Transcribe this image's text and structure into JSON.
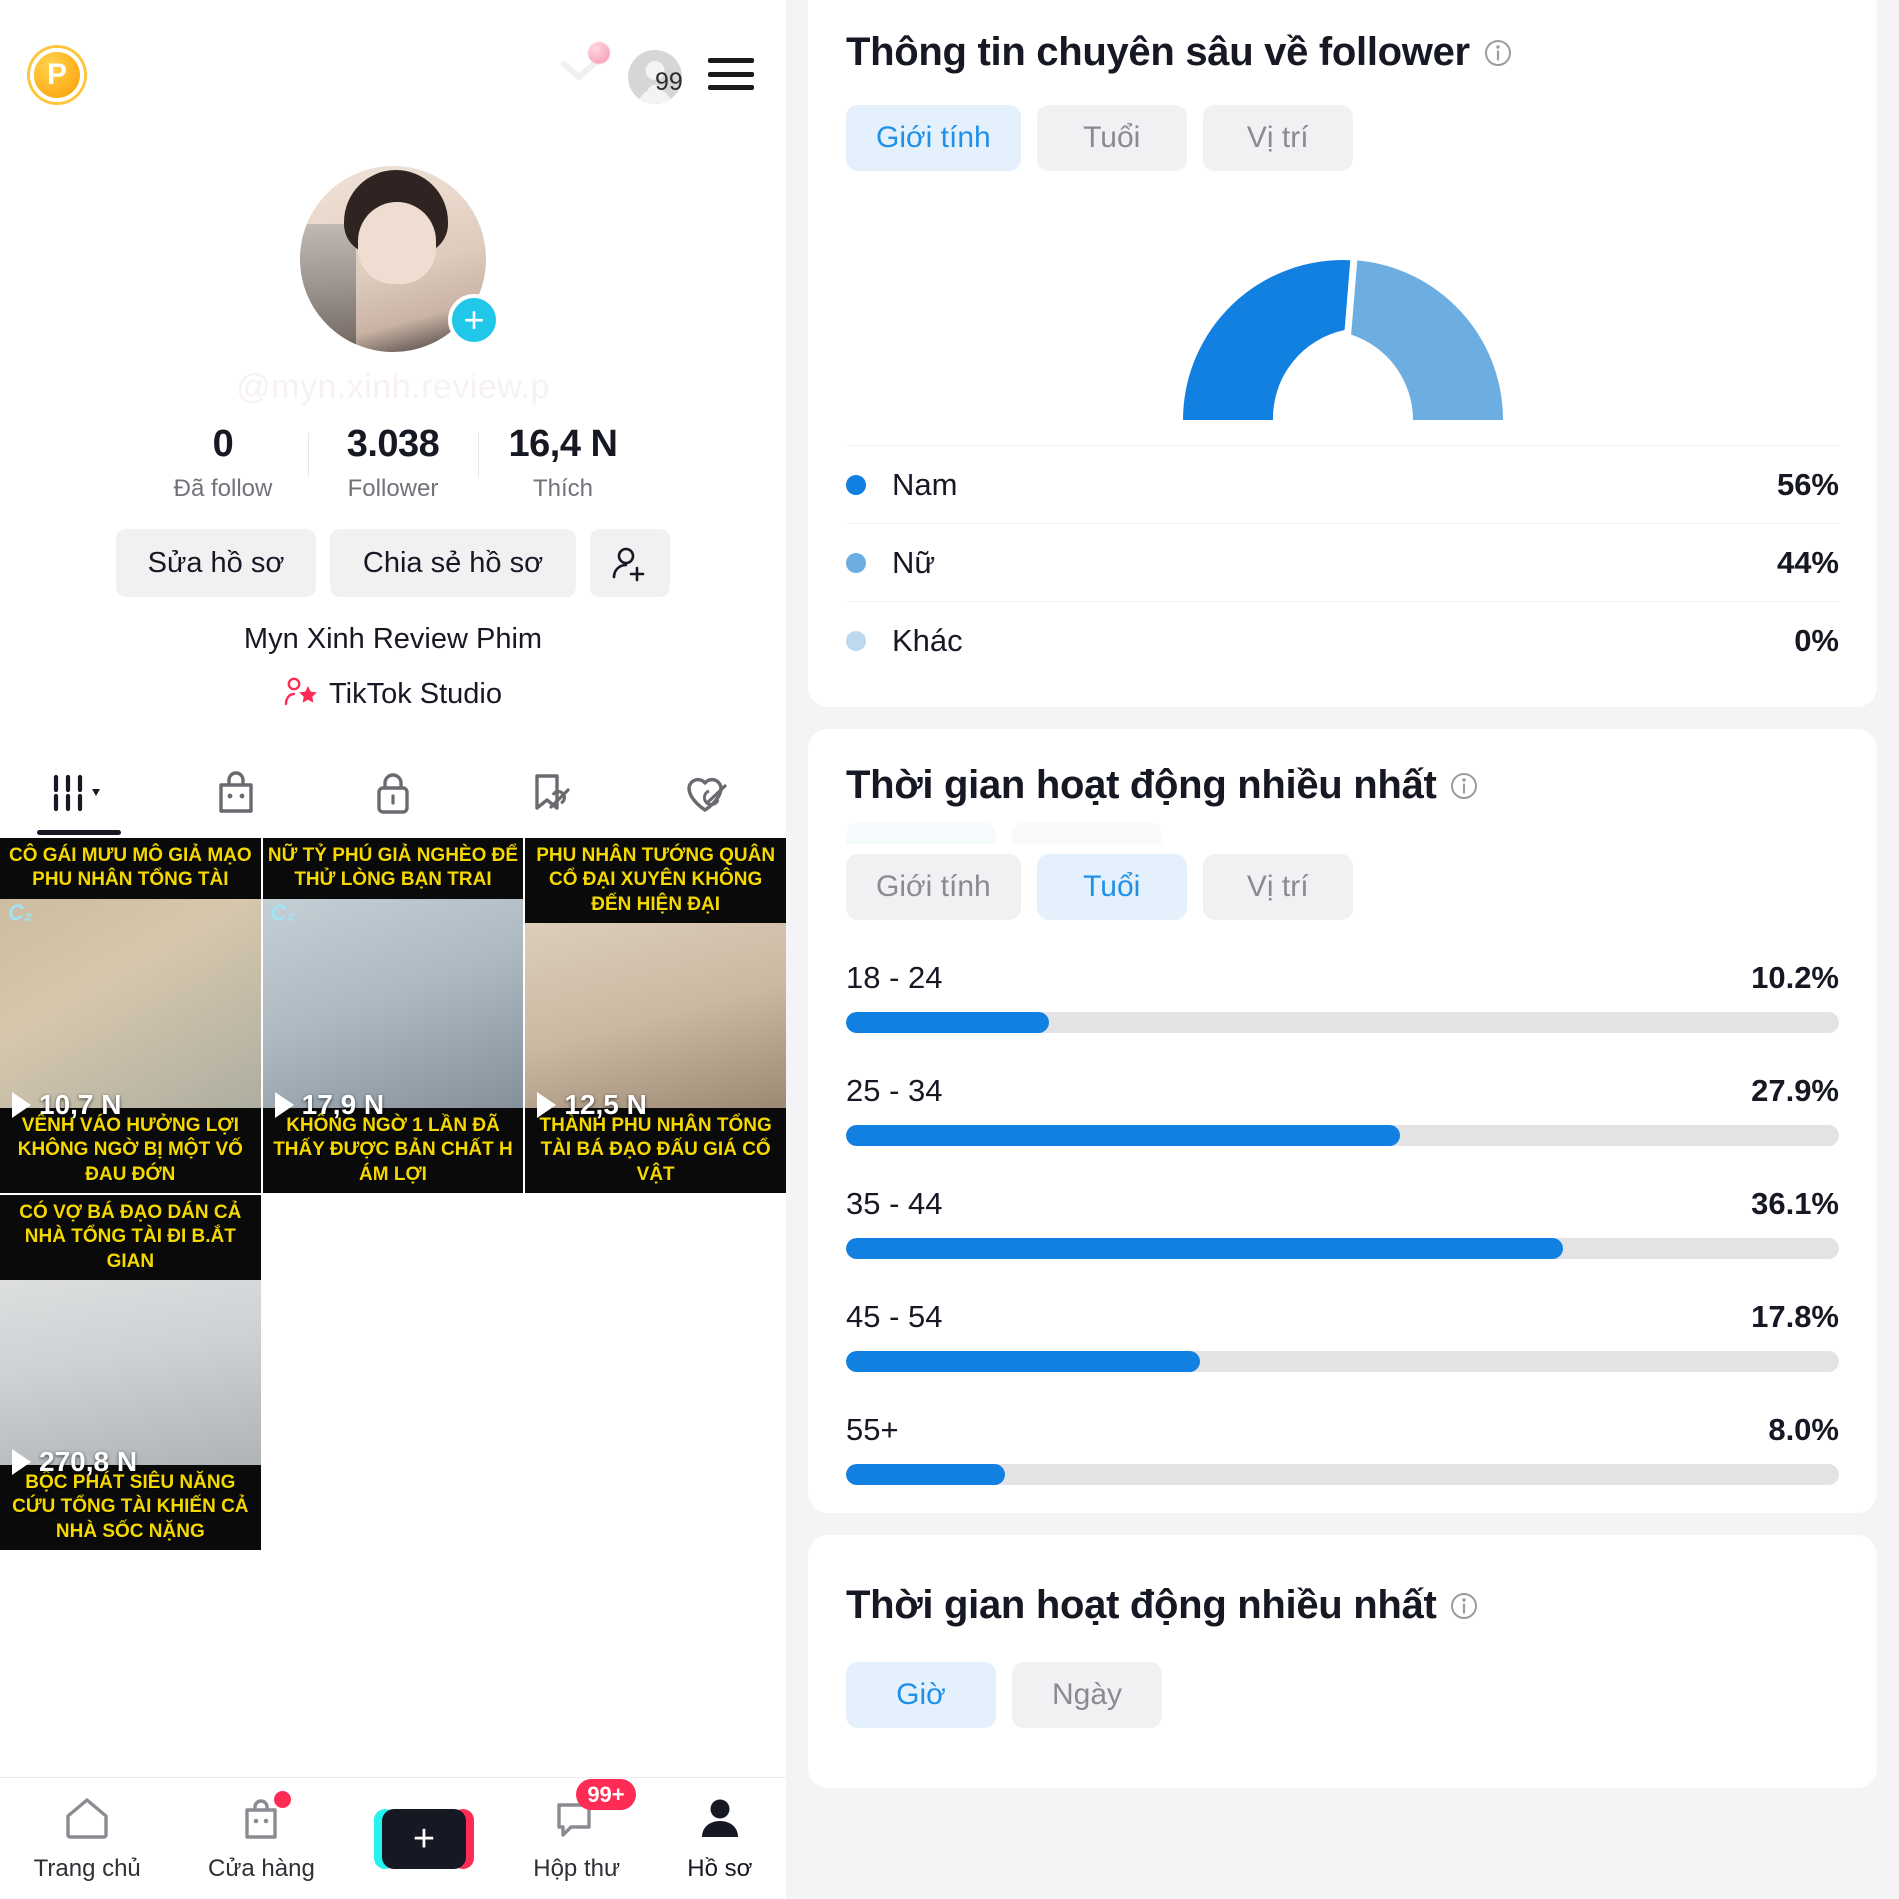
{
  "profile": {
    "coin_badge": "P",
    "top_avatar_count": "99",
    "handle_watermark": "@myn.xinh.review.p",
    "display_name": "Myn Xinh Review Phim",
    "studio_label": "TikTok Studio",
    "stats": [
      {
        "num": "0",
        "label": "Đã follow"
      },
      {
        "num": "3.038",
        "label": "Follower"
      },
      {
        "num": "16,4 N",
        "label": "Thích"
      }
    ],
    "actions": {
      "edit": "Sửa hồ sơ",
      "share": "Chia sẻ hồ sơ",
      "add_friend_icon": "add-person-icon"
    },
    "tabs": [
      {
        "icon": "grid-posts-icon",
        "active": true
      },
      {
        "icon": "shopping-bag-icon",
        "active": false
      },
      {
        "icon": "lock-private-icon",
        "active": false
      },
      {
        "icon": "bookmark-off-icon",
        "active": false
      },
      {
        "icon": "heart-hidden-icon",
        "active": false
      }
    ],
    "videos": [
      {
        "top_caption": "CÔ GÁI MƯU MÔ GIẢ MẠO PHU NHÂN TỔNG TÀI",
        "bottom_caption": "VÊNH VÁO HƯỞNG LỢI KHÔNG NGỜ BỊ MỘT VỐ ĐAU ĐỚN",
        "views": "10,7 N"
      },
      {
        "top_caption": "NỮ TỶ PHÚ GIẢ NGHÈO ĐỂ THỬ LÒNG BẠN TRAI",
        "bottom_caption": "KHÔNG NGỜ 1 LẦN ĐÃ THẤY ĐƯỢC BẢN CHẤT H ÁM LỢI",
        "views": "17,9 N"
      },
      {
        "top_caption": "PHU NHÂN TƯỚNG QUÂN CỔ ĐẠI XUYÊN KHÔNG ĐẾN HIỆN ĐẠI",
        "bottom_caption": "THÀNH PHU NHÂN TỔNG TÀI BÁ ĐẠO ĐẤU GIÁ CỔ VẬT",
        "views": "12,5 N"
      },
      {
        "top_caption": "CÓ VỢ BÁ ĐẠO DÁN CẢ NHÀ TỔNG TÀI ĐI B.ẮT GIAN",
        "bottom_caption": "BỘC PHÁT SIÊU NĂNG CỨU TỔNG TÀI KHIẾN CẢ NHÀ SỐC NẶNG",
        "views": "270,8 N"
      }
    ],
    "bottom_nav": [
      {
        "label": "Trang chủ",
        "icon": "home-icon",
        "active": false,
        "badge": null,
        "dot": false
      },
      {
        "label": "Cửa hàng",
        "icon": "shop-bag-icon",
        "active": false,
        "badge": null,
        "dot": true
      },
      {
        "label": "",
        "icon": "create-plus-icon",
        "active": false,
        "badge": null,
        "dot": false
      },
      {
        "label": "Hộp thư",
        "icon": "inbox-icon",
        "active": false,
        "badge": "99+",
        "dot": false
      },
      {
        "label": "Hồ sơ",
        "icon": "profile-person-icon",
        "active": true,
        "badge": null,
        "dot": false
      }
    ]
  },
  "analytics": {
    "follower_insight": {
      "title": "Thông tin chuyên sâu về follower",
      "info_icon": "info-circle-icon",
      "tabs": [
        {
          "label": "Giới tính",
          "active": true
        },
        {
          "label": "Tuổi",
          "active": false
        },
        {
          "label": "Vị trí",
          "active": false
        }
      ]
    },
    "most_active_age": {
      "title": "Thời gian hoạt động nhiều nhất",
      "info_icon": "info-circle-icon",
      "tabs": [
        {
          "label": "Giới tính",
          "active": false
        },
        {
          "label": "Tuổi",
          "active": true
        },
        {
          "label": "Vị trí",
          "active": false
        }
      ]
    },
    "most_active_time": {
      "title": "Thời gian hoạt động nhiều nhất",
      "info_icon": "info-circle-icon",
      "tabs": [
        {
          "label": "Giờ",
          "active": true
        },
        {
          "label": "Ngày",
          "active": false
        }
      ]
    }
  },
  "colors": {
    "primary_blue": "#1180e0",
    "light_blue": "#6daee2",
    "pale_blue": "#bcd9f0",
    "accent_pink": "#fe2c55",
    "track_grey": "#e3e3e5",
    "pill_active_bg": "#e4f1fc",
    "pill_active_text": "#2090e8"
  },
  "chart_data": [
    {
      "type": "pie",
      "title": "Thông tin chuyên sâu về follower",
      "subtitle": "Giới tính",
      "shape": "half-donut",
      "labels": [
        "Nam",
        "Nữ",
        "Khác"
      ],
      "values": [
        56,
        44,
        0
      ],
      "value_labels": [
        "56%",
        "44%",
        "0%"
      ],
      "colors": [
        "#1180e0",
        "#6daee2",
        "#bcd9f0"
      ],
      "legend": "bottom-list",
      "unit": "%"
    },
    {
      "type": "bar",
      "orientation": "horizontal",
      "title": "Thời gian hoạt động nhiều nhất",
      "subtitle": "Tuổi",
      "categories": [
        "18 - 24",
        "25 - 34",
        "35 - 44",
        "45 - 54",
        "55+"
      ],
      "values": [
        10.2,
        27.9,
        36.1,
        17.8,
        8.0
      ],
      "value_labels": [
        "10.2%",
        "27.9%",
        "36.1%",
        "17.8%",
        "8.0%"
      ],
      "xlabel": "",
      "ylabel": "",
      "xlim": [
        0,
        100
      ],
      "grid": false,
      "bar_color": "#1180e0",
      "track_color": "#e3e3e5"
    }
  ]
}
